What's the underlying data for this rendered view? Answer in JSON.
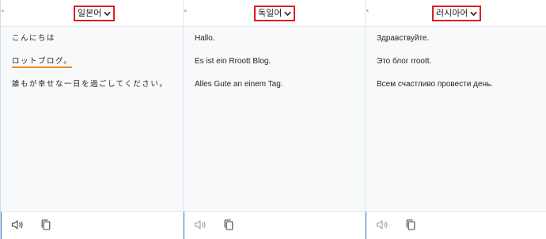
{
  "panels": [
    {
      "language": "일본어",
      "lines": [
        "こんにちは",
        "ロットブログ。",
        "誰もが幸せな一日を過ごしてください。"
      ]
    },
    {
      "language": "독일어",
      "lines": [
        "Hallo.",
        "Es ist ein Rroott Blog.",
        "Alles Gute an einem Tag."
      ]
    },
    {
      "language": "러시아어",
      "lines": [
        "Здравствуйте.",
        "Это блог rroott.",
        "Всем счастливо провести день."
      ]
    }
  ],
  "colors": {
    "highlight_border": "#e01b22",
    "underline": "#f08a24",
    "body_background": "#f7f9fb",
    "footer_accent": "#4a7cd6"
  },
  "icons": [
    "chevron-down-icon",
    "speaker-icon",
    "copy-icon"
  ]
}
